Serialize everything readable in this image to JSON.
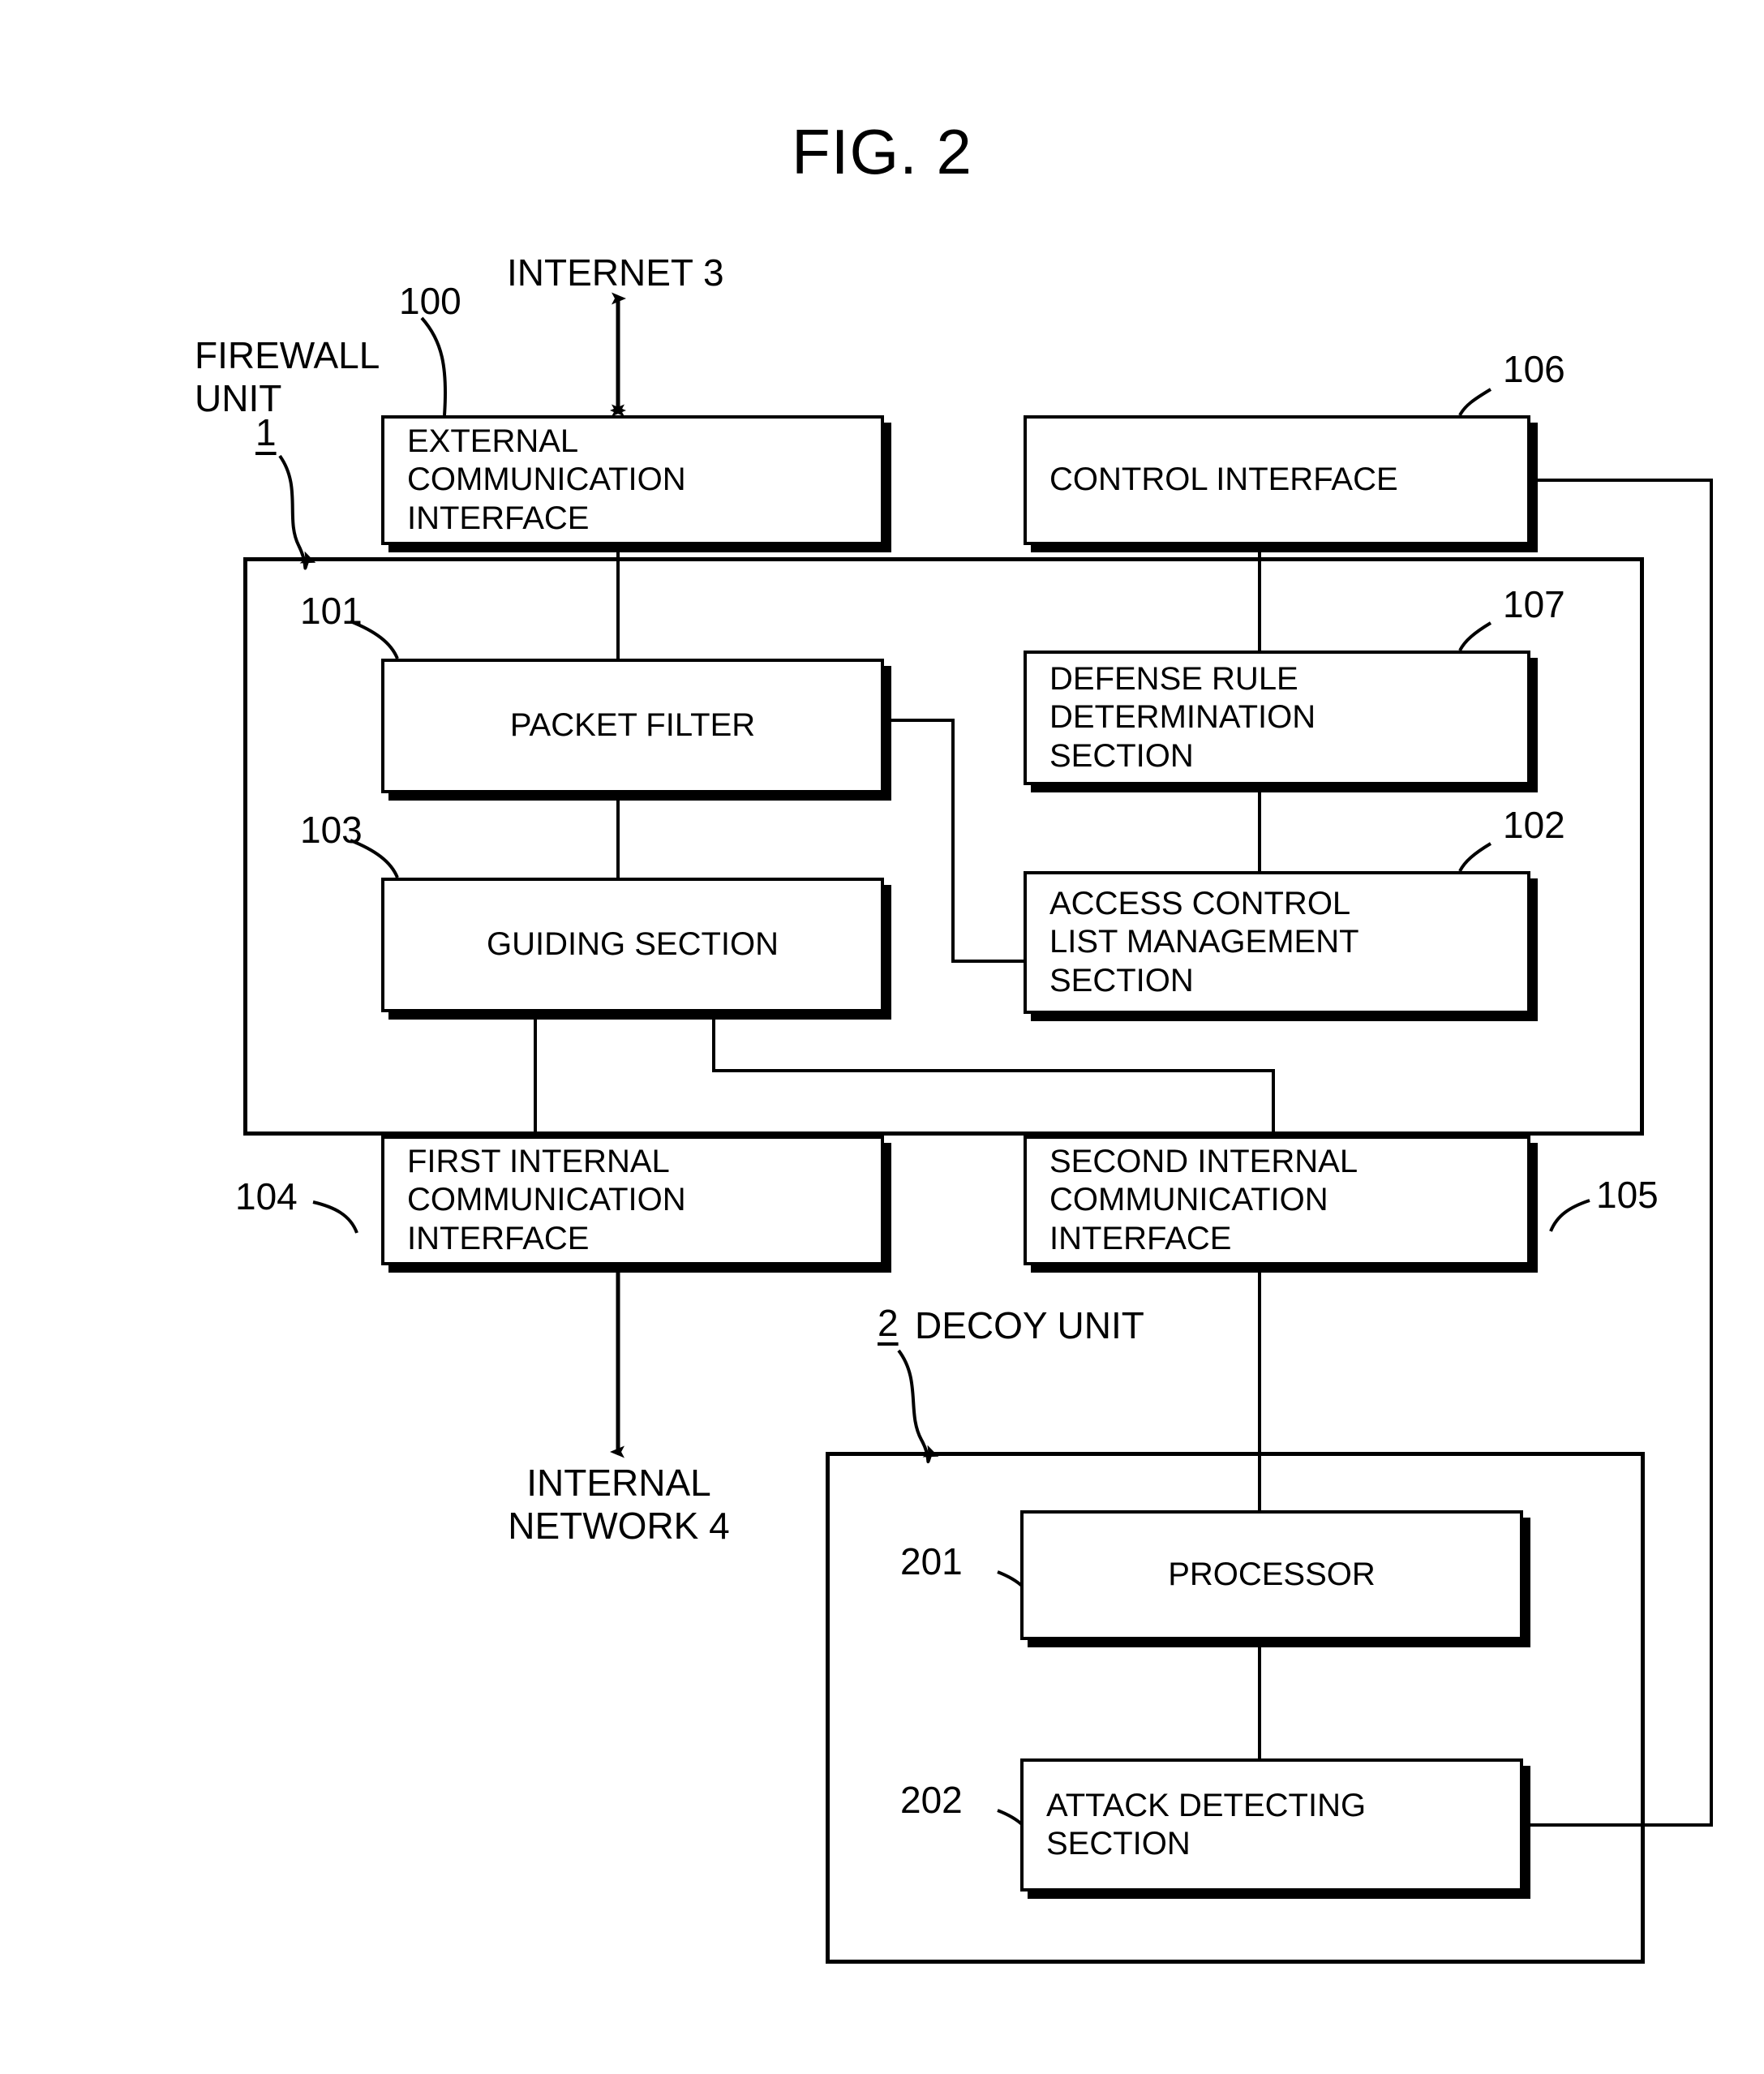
{
  "figure": {
    "title": "FIG. 2"
  },
  "annotations": {
    "firewall_unit_label": "FIREWALL\nUNIT",
    "firewall_unit_number": "1",
    "internet_label": "INTERNET 3",
    "internal_network_label": "INTERNAL\nNETWORK 4",
    "decoy_unit_number": "2",
    "decoy_unit_label": "DECOY UNIT"
  },
  "blocks": {
    "external_communication_interface": {
      "label": "EXTERNAL\nCOMMUNICATION\nINTERFACE",
      "ref": "100"
    },
    "control_interface": {
      "label": "CONTROL INTERFACE",
      "ref": "106"
    },
    "packet_filter": {
      "label": "PACKET FILTER",
      "ref": "101"
    },
    "defense_rule_determination_section": {
      "label": "DEFENSE RULE\nDETERMINATION\nSECTION",
      "ref": "107"
    },
    "guiding_section": {
      "label": "GUIDING SECTION",
      "ref": "103"
    },
    "access_control_list_management_section": {
      "label": "ACCESS CONTROL\nLIST MANAGEMENT\nSECTION",
      "ref": "102"
    },
    "first_internal_communication_interface": {
      "label": "FIRST INTERNAL\nCOMMUNICATION\nINTERFACE",
      "ref": "104"
    },
    "second_internal_communication_interface": {
      "label": "SECOND INTERNAL\nCOMMUNICATION\nINTERFACE",
      "ref": "105"
    },
    "processor": {
      "label": "PROCESSOR",
      "ref": "201"
    },
    "attack_detecting_section": {
      "label": "ATTACK DETECTING\nSECTION",
      "ref": "202"
    }
  },
  "colors": {
    "ink": "#000000",
    "paper": "#ffffff"
  }
}
